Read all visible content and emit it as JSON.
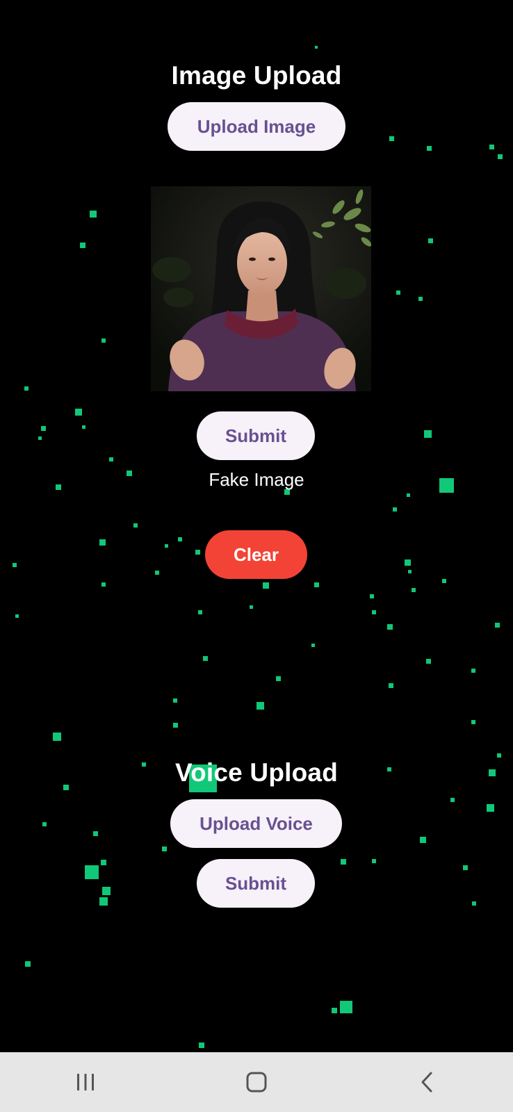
{
  "image_section": {
    "title": "Image Upload",
    "upload_button": "Upload Image",
    "submit_button": "Submit",
    "result_text": "Fake Image",
    "clear_button": "Clear"
  },
  "voice_section": {
    "title": "Voice Upload",
    "upload_button": "Upload Voice",
    "submit_button": "Submit"
  },
  "colors": {
    "background": "#000000",
    "particle": "#10c877",
    "button_bg": "#f7f1f9",
    "button_text": "#675191",
    "clear_bg": "#f34336",
    "navbar_bg": "#e6e6e6"
  },
  "nav": {
    "icons": [
      "recent-apps-icon",
      "home-icon",
      "back-icon"
    ]
  }
}
